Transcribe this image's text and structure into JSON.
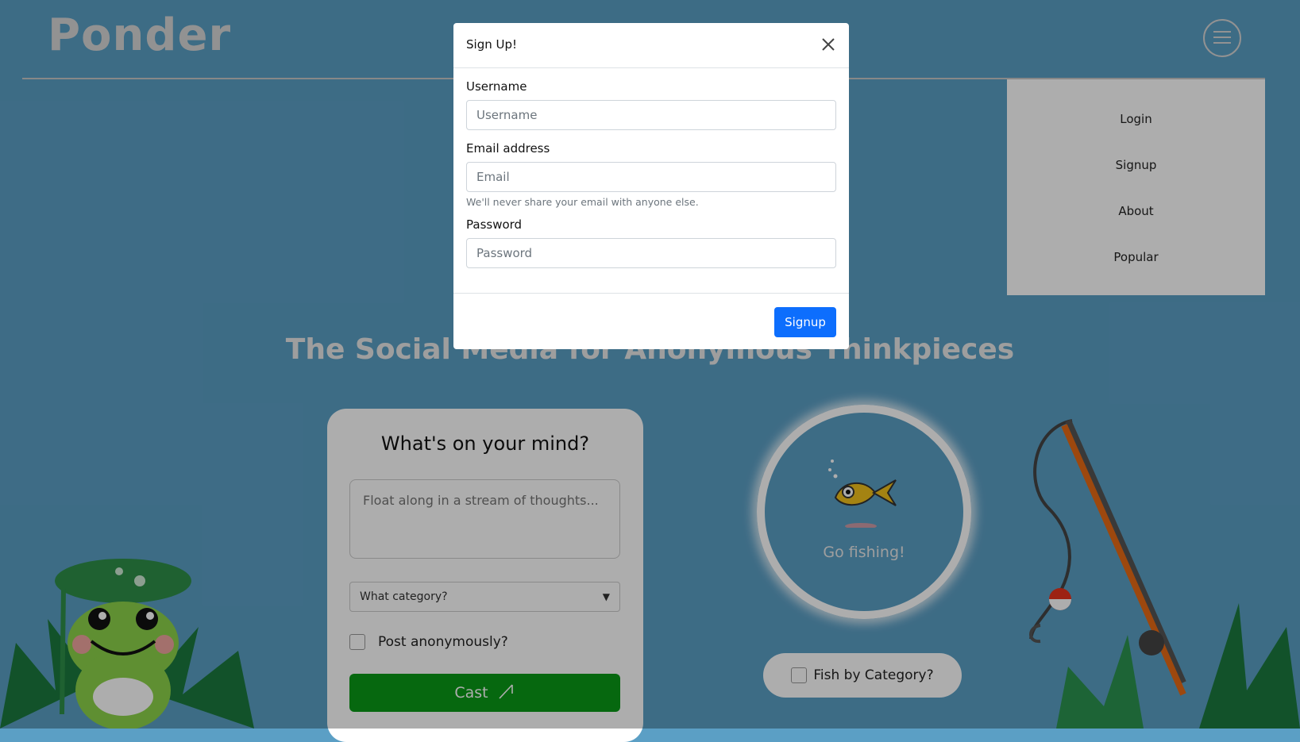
{
  "header": {
    "logo": "Ponder"
  },
  "nav": {
    "items": [
      "Login",
      "Signup",
      "About",
      "Popular"
    ]
  },
  "hero": {
    "tagline": "The Social Media for Anonymous Thinkpieces"
  },
  "post_form": {
    "title": "What's on your mind?",
    "thought_placeholder": "Float along in a stream of thoughts...",
    "category_placeholder": "What category?",
    "anonymous_label": "Post anonymously?",
    "cast_label": "Cast"
  },
  "fishing": {
    "go_label": "Go fishing!",
    "category_label": "Fish by Category?"
  },
  "signup_modal": {
    "title": "Sign Up!",
    "username_label": "Username",
    "username_placeholder": "Username",
    "email_label": "Email address",
    "email_placeholder": "Email",
    "email_help": "We'll never share your email with anyone else.",
    "password_label": "Password",
    "password_placeholder": "Password",
    "submit_label": "Signup"
  },
  "colors": {
    "background": "#5b9fc5",
    "cast_button": "#0a9a17",
    "signup_button": "#0d6efd"
  },
  "icons": [
    "hamburger-icon",
    "close-icon",
    "chevron-down-icon",
    "fishing-rod-icon",
    "fish-icon",
    "frog-illustration",
    "fishing-rod-illustration"
  ]
}
